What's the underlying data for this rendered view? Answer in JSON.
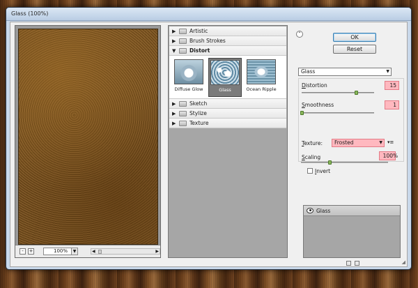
{
  "window": {
    "title": "Glass (100%)"
  },
  "preview": {
    "zoom_out": "-",
    "zoom_in": "+",
    "zoom_value": "100%",
    "zoom_dropdown": "▼",
    "scroll_left": "◀",
    "scroll_right": "▶"
  },
  "gallery": {
    "folders_top": [
      {
        "label": "Artistic",
        "arrow": "▶"
      },
      {
        "label": "Brush Strokes",
        "arrow": "▶"
      },
      {
        "label": "Distort",
        "arrow": "▼"
      }
    ],
    "thumbnails": [
      {
        "label": "Diffuse Glow"
      },
      {
        "label": "Glass"
      },
      {
        "label": "Ocean Ripple"
      }
    ],
    "folders_bottom": [
      {
        "label": "Sketch",
        "arrow": "▶"
      },
      {
        "label": "Stylize",
        "arrow": "▶"
      },
      {
        "label": "Texture",
        "arrow": "▶"
      }
    ]
  },
  "panel": {
    "collapse_icon": "⌃",
    "ok_label": "OK",
    "reset_label": "Reset",
    "filter_selected": "Glass",
    "dd_arrow": "▼",
    "distortion_label_u": "D",
    "distortion_label_rest": "istortion",
    "distortion_value": "15",
    "distortion_fraction": 0.75,
    "smoothness_label_u": "S",
    "smoothness_label_rest": "moothness",
    "smoothness_value": "1",
    "smoothness_fraction": 0.0,
    "texture_label_u": "T",
    "texture_label_rest": "exture:",
    "texture_selected": "Frosted",
    "texture_menu_icon": "▾≡",
    "scaling_label_u": "S",
    "scaling_label_rest": "caling",
    "scaling_value": "100",
    "scaling_unit": "%",
    "scaling_fraction": 0.33,
    "invert_label_u": "I",
    "invert_label_rest": "nvert",
    "invert_checked": false
  },
  "layers": {
    "items": [
      {
        "name": "Glass"
      }
    ]
  },
  "colors": {
    "highlight_field": "#ffb8bf",
    "slider_thumb": "#8ab65c"
  }
}
